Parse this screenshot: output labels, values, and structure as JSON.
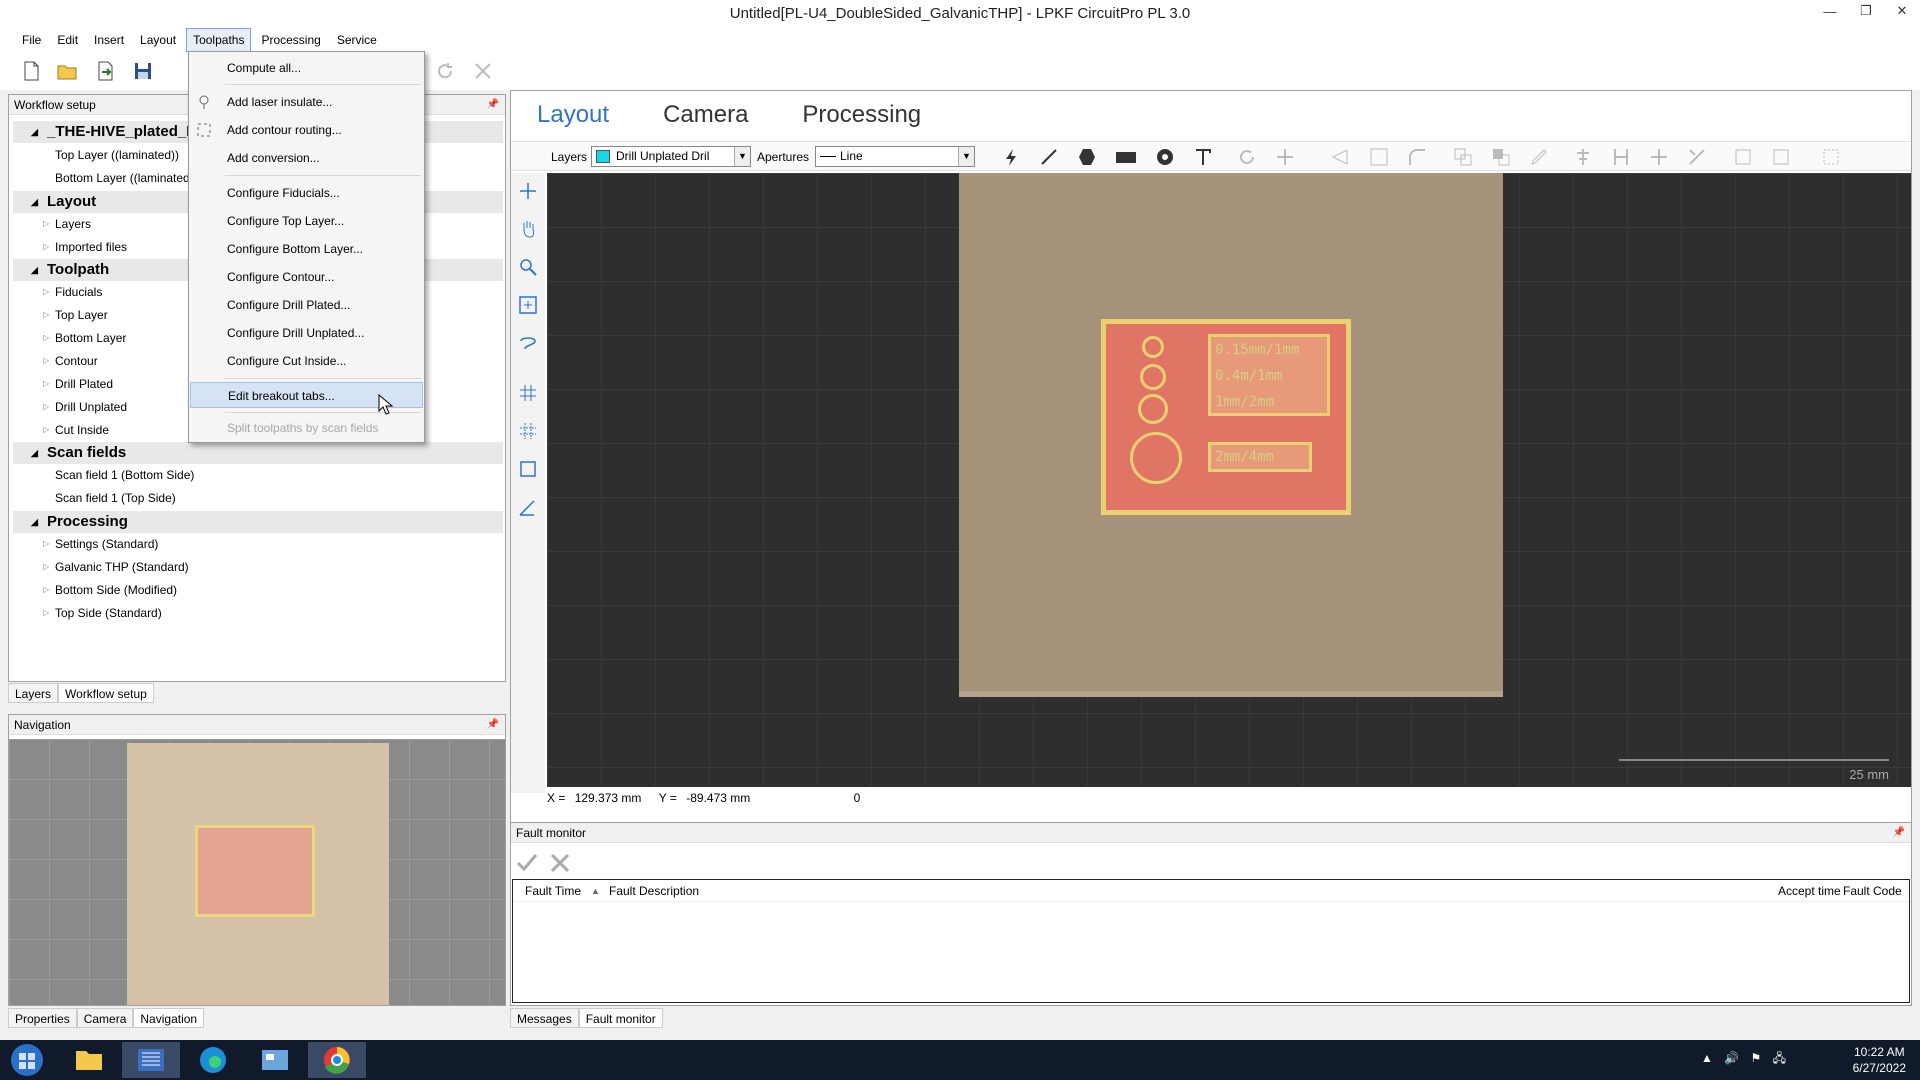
{
  "window": {
    "title": "Untitled[PL-U4_DoubleSided_GalvanicTHP] - LPKF CircuitPro PL 3.0",
    "minimize": "—",
    "restore": "❐",
    "close": "✕"
  },
  "menubar": [
    "File",
    "Edit",
    "Insert",
    "Layout",
    "Toolpaths",
    "Processing",
    "Service"
  ],
  "toolpaths_menu": {
    "items": [
      {
        "label": "Compute all...",
        "enabled": true
      },
      {
        "label": "Add laser insulate...",
        "enabled": true
      },
      {
        "label": "Add contour routing...",
        "enabled": true
      },
      {
        "label": "Add conversion...",
        "enabled": true
      },
      {
        "label": "Configure Fiducials...",
        "enabled": true
      },
      {
        "label": "Configure Top Layer...",
        "enabled": true
      },
      {
        "label": "Configure Bottom Layer...",
        "enabled": true
      },
      {
        "label": "Configure Contour...",
        "enabled": true
      },
      {
        "label": "Configure Drill Plated...",
        "enabled": true
      },
      {
        "label": "Configure Drill Unplated...",
        "enabled": true
      },
      {
        "label": "Configure Cut Inside...",
        "enabled": true
      },
      {
        "label": "Edit breakout tabs...",
        "enabled": true,
        "highlighted": true
      },
      {
        "label": "Split toolpaths by scan fields",
        "enabled": false
      }
    ]
  },
  "workflow": {
    "header": "Workflow setup",
    "project": "_THE-HIVE_plated_F",
    "project_children": [
      "Top Layer ((laminated))",
      "Bottom Layer ((laminated))"
    ],
    "sections": [
      {
        "title": "Layout",
        "items": [
          "Layers",
          "Imported files"
        ]
      },
      {
        "title": "Toolpath",
        "items": [
          "Fiducials",
          "Top Layer",
          "Bottom Layer",
          "Contour",
          "Drill Plated",
          "Drill Unplated",
          "Cut Inside"
        ]
      },
      {
        "title": "Scan fields",
        "items": [
          "Scan field 1 (Bottom Side)",
          "Scan field 1 (Top Side)"
        ]
      },
      {
        "title": "Processing",
        "items": [
          "Settings (Standard)",
          "Galvanic THP (Standard)",
          "Bottom Side (Modified)",
          "Top Side (Standard)"
        ]
      }
    ],
    "tabs": [
      "Layers",
      "Workflow setup"
    ]
  },
  "navigation": {
    "header": "Navigation",
    "tabs": [
      "Properties",
      "Camera",
      "Navigation"
    ]
  },
  "main": {
    "tabs": [
      "Layout",
      "Camera",
      "Processing"
    ],
    "layers_label": "Layers",
    "layer_value": "Drill Unplated Dril",
    "apertures_label": "Apertures",
    "aperture_value": "Line",
    "scale_label": "25 mm",
    "coords": {
      "x_label": "X =",
      "x": "129.373 mm",
      "y_label": "Y =",
      "y": "-89.473 mm",
      "extra": "0"
    },
    "pcb_labels": [
      "0.15mm/1mm",
      "0.4m/1mm",
      "1mm/2mm",
      "2mm/4mm"
    ]
  },
  "fault_monitor": {
    "header": "Fault monitor",
    "columns": [
      "Fault Time",
      "Fault Description",
      "Accept time",
      "Fault Code"
    ],
    "tabs": [
      "Messages",
      "Fault monitor"
    ]
  },
  "taskbar": {
    "time": "10:22 AM",
    "date": "6/27/2022"
  },
  "colors": {
    "accent": "#2f74c5",
    "canvas": "#2e2e2e",
    "board": "#a6927a",
    "pcb_copper": "#e17565",
    "pcb_outline": "#e9d172"
  }
}
